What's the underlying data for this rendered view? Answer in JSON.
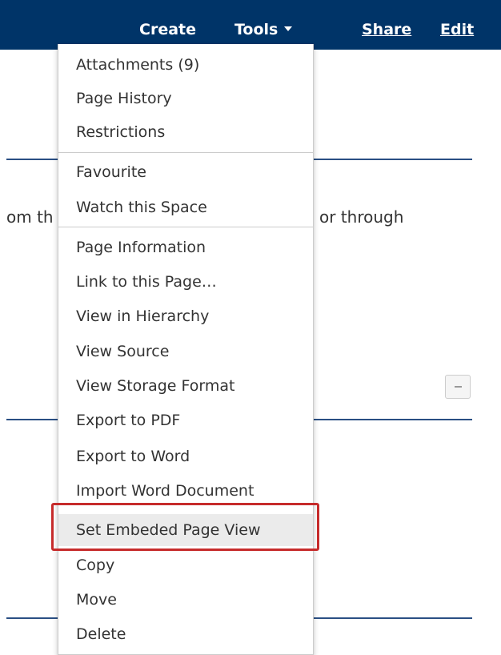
{
  "header": {
    "create_label": "Create",
    "tools_label": "Tools",
    "share_label": "Share",
    "edit_label": "Edit",
    "background_color": "#003468"
  },
  "page": {
    "text_left": "om th",
    "text_right": "or through"
  },
  "tools_menu": {
    "group1": [
      "Attachments (9)",
      "Page History",
      "Restrictions"
    ],
    "group2": [
      "Favourite",
      "Watch this Space"
    ],
    "group3": [
      "Page Information",
      "Link to this Page…",
      "View in Hierarchy",
      "View Source",
      "View Storage Format",
      "Export to PDF",
      "Export to Word",
      "Import Word Document",
      "Set Embeded Page View",
      "Copy",
      "Move",
      "Delete"
    ],
    "highlighted_item": "Set Embeded Page View",
    "annotation_color": "#c62b2b"
  }
}
